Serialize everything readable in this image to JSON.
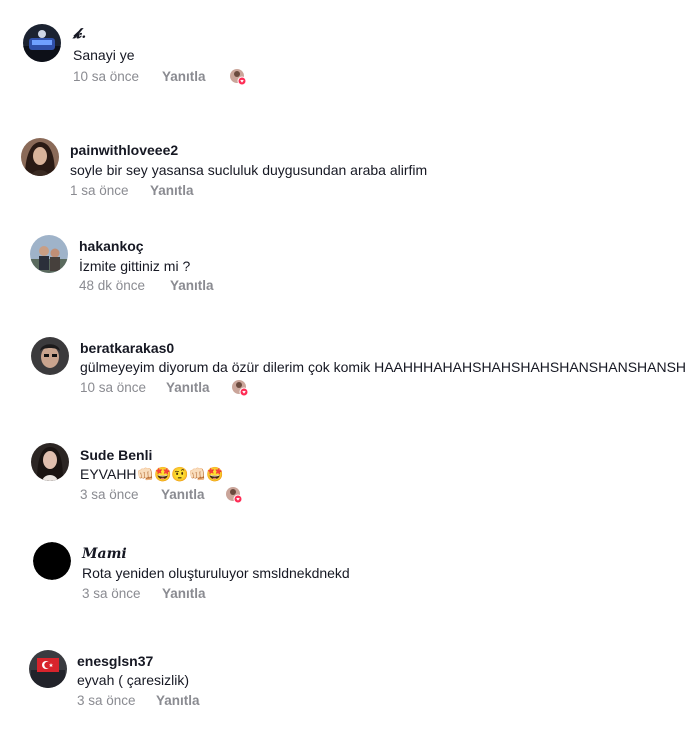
{
  "comments": [
    {
      "username": "𝓴.",
      "text": "Sanayi ye",
      "time": "10 sa önce",
      "reply": "Yanıtla",
      "creator_liked": true,
      "avatar": "dark-car-avatar"
    },
    {
      "username": "painwithloveee2",
      "text": "soyle bir sey yasansa sucluluk duygusundan araba alirfim",
      "time": "1 sa önce",
      "reply": "Yanıtla",
      "creator_liked": false,
      "avatar": "brunette-avatar"
    },
    {
      "username": "hakankoç",
      "text": "İzmite gittiniz mi ?",
      "time": "48 dk önce",
      "reply": "Yanıtla",
      "creator_liked": false,
      "avatar": "outdoor-avatar"
    },
    {
      "username": "beratkarakas0",
      "text": "gülmeyeyim diyorum da özür dilerim çok komik HAAHHHAHAHSHAHSHAHSHANSHANSHANSH",
      "time": "10 sa önce",
      "reply": "Yanıtla",
      "creator_liked": true,
      "avatar": "selfie-avatar"
    },
    {
      "username": "Sude Benli",
      "text": "EYVAHH👊🏻🤩🤨👊🏻🤩",
      "time": "3 sa önce",
      "reply": "Yanıtla",
      "creator_liked": true,
      "avatar": "long-hair-avatar"
    },
    {
      "username": "𝑴𝒂𝒎𝒊",
      "text": "Rota yeniden oluşturuluyor smsldnekdnekd",
      "time": "3 sa önce",
      "reply": "Yanıtla",
      "creator_liked": false,
      "avatar": "black-avatar"
    },
    {
      "username": "enesglsn37",
      "text": "eyvah ( çaresizlik)",
      "time": "3 sa önce",
      "reply": "Yanıtla",
      "creator_liked": false,
      "avatar": "flag-avatar"
    }
  ],
  "colors": {
    "text": "#161823",
    "muted": "#8a8b91",
    "like": "#fe2c55"
  }
}
